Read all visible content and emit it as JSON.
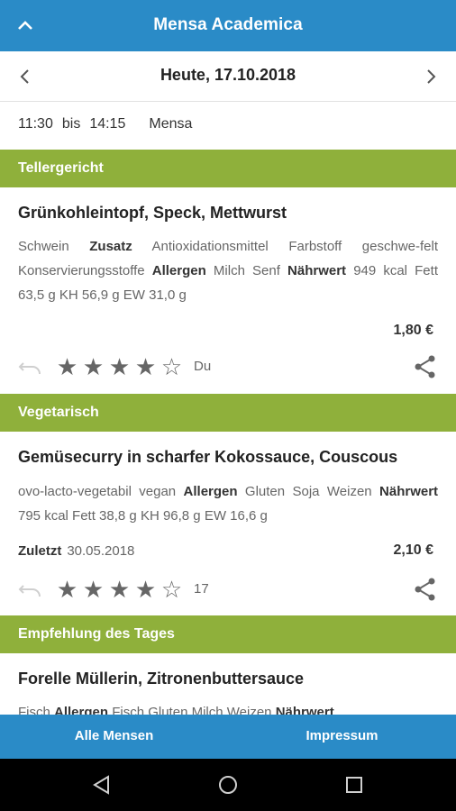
{
  "appbar": {
    "title": "Mensa Academica"
  },
  "date": {
    "label": "Heute, 17.10.2018"
  },
  "hours": {
    "start": "11:30",
    "sep": "bis",
    "end": "14:15",
    "place": "Mensa"
  },
  "colors": {
    "primary": "#2a8bc7",
    "section": "#8fb03b"
  },
  "sections": [
    {
      "title": "Tellergericht",
      "dish": {
        "name": "Grünkohleintopf, Speck, Mettwurst",
        "desc": [
          {
            "t": "Schwein",
            "b": false
          },
          {
            "t": "Zusatz",
            "b": true
          },
          {
            "t": "Antioxidationsmittel",
            "b": false
          },
          {
            "t": "Farbstoff",
            "b": false
          },
          {
            "t": "geschwe-felt",
            "b": false
          },
          {
            "t": "Konservierungsstoffe",
            "b": false
          },
          {
            "t": "Allergen",
            "b": true
          },
          {
            "t": "Milch",
            "b": false
          },
          {
            "t": "Senf",
            "b": false
          },
          {
            "t": "Nährwert",
            "b": true
          },
          {
            "t": "949 kcal",
            "b": false
          },
          {
            "t": "Fett 63,5 g",
            "b": false
          },
          {
            "t": "KH 56,9 g",
            "b": false
          },
          {
            "t": "EW 31,0 g",
            "b": false
          }
        ],
        "price": "1,80 €",
        "rating": 4,
        "rating_label": "Du"
      }
    },
    {
      "title": "Vegetarisch",
      "dish": {
        "name": "Gemüsecurry in scharfer Kokossauce, Couscous",
        "desc": [
          {
            "t": "ovo-lacto-vegetabil",
            "b": false
          },
          {
            "t": "vegan",
            "b": false
          },
          {
            "t": "Allergen",
            "b": true
          },
          {
            "t": "Gluten",
            "b": false
          },
          {
            "t": "Soja",
            "b": false
          },
          {
            "t": "Weizen",
            "b": false
          },
          {
            "t": "Nährwert",
            "b": true
          },
          {
            "t": "795 kcal",
            "b": false
          },
          {
            "t": "Fett 38,8 g",
            "b": false
          },
          {
            "t": "KH 96,8 g",
            "b": false
          },
          {
            "t": "EW 16,6 g",
            "b": false
          }
        ],
        "last_label": "Zuletzt",
        "last_date": "30.05.2018",
        "price": "2,10 €",
        "rating": 4,
        "rating_label": "17"
      }
    },
    {
      "title": "Empfehlung des Tages",
      "dish": {
        "name": "Forelle Müllerin, Zitronenbuttersauce",
        "desc": [
          {
            "t": "Fisch",
            "b": false
          },
          {
            "t": "Allergen",
            "b": true
          },
          {
            "t": "Fisch",
            "b": false
          },
          {
            "t": "Gluten",
            "b": false
          },
          {
            "t": "Milch",
            "b": false
          },
          {
            "t": "Weizen",
            "b": false
          },
          {
            "t": "Nährwert",
            "b": true
          }
        ]
      }
    }
  ],
  "bottomnav": {
    "left": "Alle Mensen",
    "right": "Impressum"
  },
  "icons": {
    "up": "chevron-up-icon",
    "prev": "chevron-left-icon",
    "next": "chevron-right-icon",
    "undo": "undo-icon",
    "star": "star-icon",
    "share": "share-icon",
    "back": "back-triangle-icon",
    "home": "home-circle-icon",
    "recents": "recents-square-icon"
  }
}
